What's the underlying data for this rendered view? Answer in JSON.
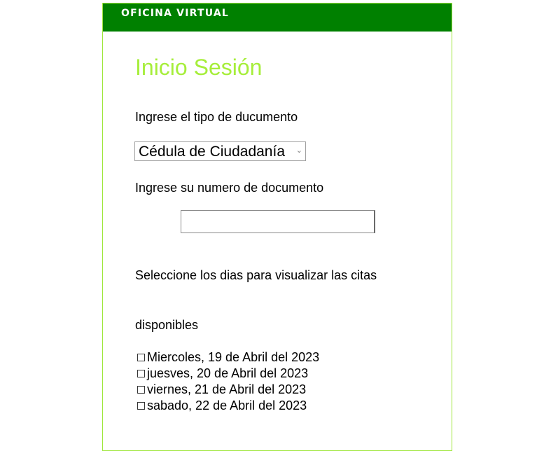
{
  "header": {
    "title": "OFICINA VIRTUAL"
  },
  "login": {
    "title": "Inicio Sesión",
    "doc_type_label": "Ingrese el tipo de ducumento",
    "doc_type_selected": "Cédula de Ciudadanía",
    "doc_number_label": "Ingrese su numero de documento",
    "doc_number_value": "",
    "days_label_line1": "Seleccione los dias para visualizar las citas",
    "days_label_line2": "disponibles",
    "days": [
      {
        "label": "Miercoles, 19 de Abril del 2023",
        "checked": false
      },
      {
        "label": "juesves, 20 de Abril del 2023",
        "checked": false
      },
      {
        "label": "viernes, 21 de Abril del 2023",
        "checked": false
      },
      {
        "label": "sabado, 22 de Abril del 2023",
        "checked": false
      }
    ]
  },
  "colors": {
    "header_bg": "#008000",
    "title_color": "#a6ee3a",
    "panel_border": "#9ee63a"
  },
  "icons": {
    "select_arrow": "chevron-down-icon"
  }
}
